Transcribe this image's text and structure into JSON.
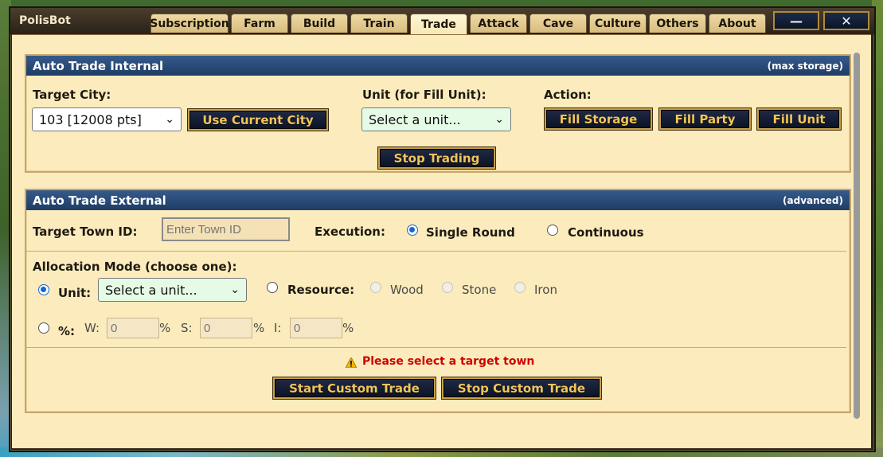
{
  "window": {
    "title": "PolisBot"
  },
  "tabs": [
    {
      "label": "Subscription"
    },
    {
      "label": "Farm"
    },
    {
      "label": "Build"
    },
    {
      "label": "Train"
    },
    {
      "label": "Trade"
    },
    {
      "label": "Attack"
    },
    {
      "label": "Cave"
    },
    {
      "label": "Culture"
    },
    {
      "label": "Others"
    },
    {
      "label": "About"
    }
  ],
  "active_tab": "Trade",
  "window_buttons": {
    "minimize": "—",
    "close": "✕"
  },
  "internal": {
    "title": "Auto Trade Internal",
    "badge": "(max storage)",
    "target_city_label": "Target City:",
    "target_city_value": "103 [12008 pts]",
    "use_current_city": "Use Current City",
    "unit_label": "Unit (for Fill Unit):",
    "unit_value": "Select a unit...",
    "action_label": "Action:",
    "fill_storage": "Fill Storage",
    "fill_party": "Fill Party",
    "fill_unit": "Fill Unit",
    "stop_trading": "Stop Trading"
  },
  "external": {
    "title": "Auto Trade External",
    "badge": "(advanced)",
    "target_town_label": "Target Town ID:",
    "target_town_placeholder": "Enter Town ID",
    "execution_label": "Execution:",
    "single_round": "Single Round",
    "continuous": "Continuous",
    "allocation_label": "Allocation Mode (choose one):",
    "unit_label": "Unit:",
    "unit_value": "Select a unit...",
    "resource_label": "Resource:",
    "wood": "Wood",
    "stone": "Stone",
    "iron": "Iron",
    "percent_label": "%:",
    "w_label": "W:",
    "w_value": "0",
    "s_label": "S:",
    "s_value": "0",
    "i_label": "I:",
    "i_value": "0",
    "pct": "%",
    "warning": "Please select a target town",
    "start_custom": "Start Custom Trade",
    "stop_custom": "Stop Custom Trade"
  },
  "colors": {
    "panel_bg": "#fcebbd",
    "header_blue": "#1e3d66",
    "button_gold": "#f2c55a",
    "warning_red": "#d00000",
    "radio_blue": "#1468d4"
  }
}
